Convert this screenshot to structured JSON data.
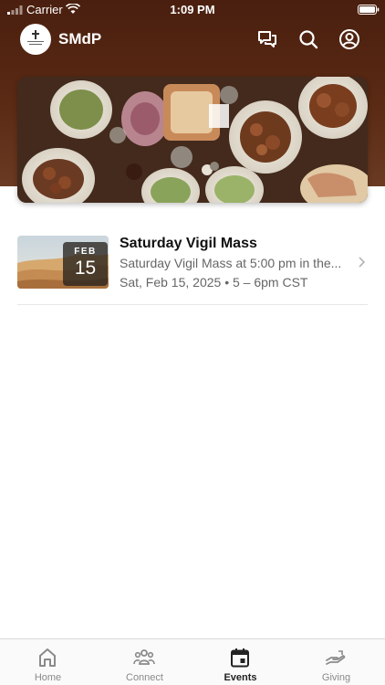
{
  "status_bar": {
    "carrier": "Carrier",
    "time": "1:09 PM"
  },
  "app": {
    "title": "SMdP",
    "logo_text": "ST MARTIN DE PORRES"
  },
  "header_actions": [
    {
      "name": "chat-icon"
    },
    {
      "name": "search-icon"
    },
    {
      "name": "profile-icon"
    }
  ],
  "hero": {
    "image": "food-table-photo"
  },
  "events": [
    {
      "title": "Saturday Vigil Mass",
      "description": "Saturday Vigil Mass at 5:00 pm in the...",
      "date_time": "Sat, Feb 15, 2025 • 5 – 6pm CST",
      "badge_month": "FEB",
      "badge_day": "15",
      "thumbnail": "desert-dunes-photo"
    }
  ],
  "tabs": [
    {
      "label": "Home",
      "icon": "home-icon",
      "active": false
    },
    {
      "label": "Connect",
      "icon": "people-icon",
      "active": false
    },
    {
      "label": "Events",
      "icon": "calendar-icon",
      "active": true
    },
    {
      "label": "Giving",
      "icon": "giving-hand-icon",
      "active": false
    }
  ],
  "colors": {
    "header_brown": "#4a1f0f",
    "active_tab": "#222222",
    "inactive_tab": "#8a8a8a"
  }
}
